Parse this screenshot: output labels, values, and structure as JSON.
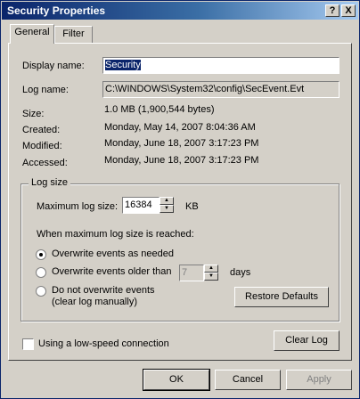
{
  "window": {
    "title": "Security Properties",
    "help_label": "?",
    "close_label": "X"
  },
  "tabs": [
    {
      "label": "General"
    },
    {
      "label": "Filter"
    }
  ],
  "general": {
    "display_name_label": "Display name:",
    "display_name_value": "Security",
    "log_name_label": "Log name:",
    "log_name_value": "C:\\WINDOWS\\System32\\config\\SecEvent.Evt",
    "size_label": "Size:",
    "size_value": "1.0 MB (1,900,544 bytes)",
    "created_label": "Created:",
    "created_value": "Monday, May 14, 2007 8:04:36 AM",
    "modified_label": "Modified:",
    "modified_value": "Monday, June 18, 2007 3:17:23 PM",
    "accessed_label": "Accessed:",
    "accessed_value": "Monday, June 18, 2007 3:17:23 PM"
  },
  "log_size": {
    "legend": "Log size",
    "max_label": "Maximum log size:",
    "max_value": "16384",
    "max_unit": "KB",
    "when_label": "When maximum log size is reached:",
    "options": [
      {
        "label": "Overwrite events as needed",
        "checked": true
      },
      {
        "label": "Overwrite events older than",
        "checked": false
      },
      {
        "label": "Do not overwrite events",
        "sub_label": "(clear log manually)",
        "checked": false
      }
    ],
    "days_value": "7",
    "days_unit": "days",
    "restore_label": "Restore Defaults"
  },
  "low_speed_label": "Using a low-speed connection",
  "clear_log_label": "Clear Log",
  "footer": {
    "ok_label": "OK",
    "cancel_label": "Cancel",
    "apply_label": "Apply"
  }
}
